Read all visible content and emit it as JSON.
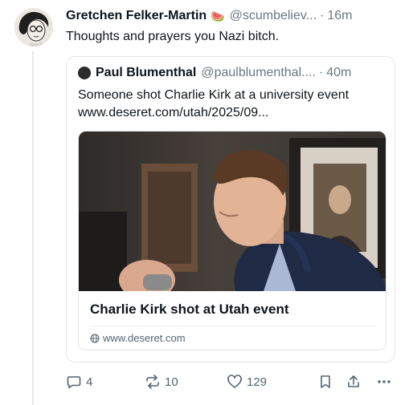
{
  "post": {
    "author_name": "Gretchen Felker-Martin",
    "author_emoji": "🍉",
    "author_handle": "@scumbeliev...",
    "separator": "·",
    "time": "16m",
    "text": "Thoughts and prayers you Nazi bitch."
  },
  "quote": {
    "author_name": "Paul Blumenthal",
    "author_handle": "@paulblumenthal....",
    "separator": "·",
    "time": "40m",
    "text": "Someone shot Charlie Kirk at a university event www.deseret.com/utah/2025/09...",
    "link_card": {
      "title": "Charlie Kirk shot at Utah event",
      "domain": "www.deseret.com"
    }
  },
  "actions": {
    "replies": "4",
    "reposts": "10",
    "likes": "129"
  },
  "icons": [
    "reply-icon",
    "repost-icon",
    "like-icon",
    "bookmark-icon",
    "share-icon",
    "more-icon",
    "globe-icon"
  ],
  "colors": {
    "text": "#0f1419",
    "muted": "#6e767d",
    "border": "#e6e6e6"
  }
}
